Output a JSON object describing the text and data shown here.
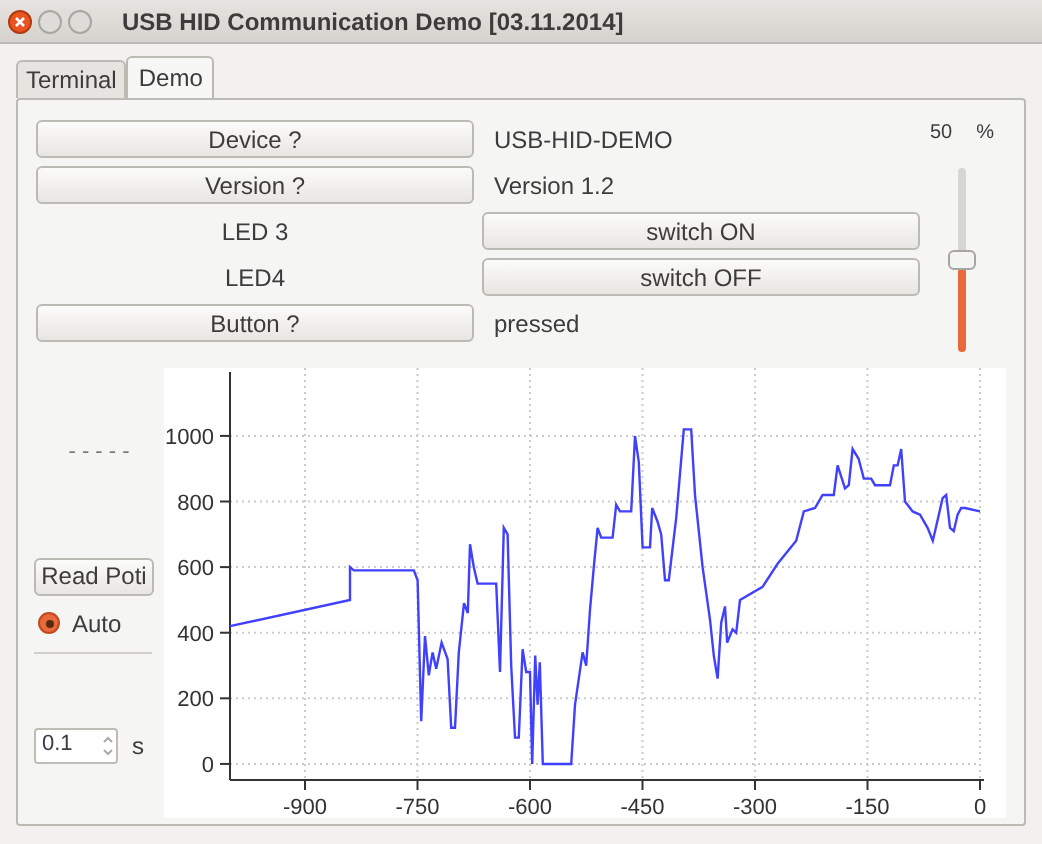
{
  "window": {
    "title": "USB HID Communication Demo [03.11.2014]"
  },
  "tabs": [
    {
      "label": "Terminal",
      "selected": false
    },
    {
      "label": "Demo",
      "selected": true
    }
  ],
  "rows": [
    {
      "kind": "query",
      "label": "Device ?",
      "value": "USB-HID-DEMO"
    },
    {
      "kind": "query",
      "label": "Version ?",
      "value": "Version 1.2"
    },
    {
      "kind": "switch",
      "label": "LED 3",
      "button": "switch ON"
    },
    {
      "kind": "switch",
      "label": "LED4",
      "button": "switch OFF"
    },
    {
      "kind": "query",
      "label": "Button ?",
      "value": "pressed"
    }
  ],
  "slider": {
    "reading": "50",
    "unit": "%",
    "level": 0.5
  },
  "poti": {
    "reading": "- - - - -",
    "button": "Read Poti",
    "auto": {
      "label": "Auto",
      "selected": true
    },
    "interval": {
      "value": "0.1",
      "unit": "s"
    }
  },
  "chart": {
    "chart_data": {
      "type": "line",
      "grid": true,
      "xlim": [
        -1000,
        0
      ],
      "ylim": [
        -49,
        1207
      ],
      "xticks": [
        -900,
        -750,
        -600,
        -450,
        -300,
        -150,
        0
      ],
      "yticks": [
        0,
        200,
        400,
        600,
        800,
        1000
      ],
      "x": [
        -1000,
        -840,
        -840,
        -835,
        -755,
        -750,
        -745,
        -740,
        -735,
        -730,
        -725,
        -718,
        -710,
        -705,
        -700,
        -695,
        -688,
        -683,
        -680,
        -675,
        -670,
        -645,
        -640,
        -635,
        -630,
        -625,
        -620,
        -615,
        -610,
        -605,
        -600,
        -597,
        -593,
        -590,
        -587,
        -583,
        -545,
        -540,
        -530,
        -525,
        -520,
        -515,
        -510,
        -505,
        -490,
        -485,
        -480,
        -465,
        -460,
        -455,
        -450,
        -440,
        -437,
        -430,
        -425,
        -420,
        -415,
        -405,
        -395,
        -385,
        -380,
        -370,
        -360,
        -355,
        -350,
        -345,
        -340,
        -337,
        -330,
        -325,
        -320,
        -290,
        -270,
        -245,
        -235,
        -220,
        -210,
        -195,
        -190,
        -180,
        -175,
        -170,
        -162,
        -155,
        -145,
        -140,
        -120,
        -115,
        -110,
        -105,
        -100,
        -90,
        -80,
        -70,
        -63,
        -58,
        -50,
        -45,
        -40,
        -35,
        -30,
        -25,
        -20,
        0
      ],
      "series": [
        {
          "color": "#4040ff",
          "values": [
            420,
            500,
            600,
            590,
            590,
            560,
            130,
            390,
            270,
            340,
            290,
            370,
            320,
            110,
            110,
            340,
            490,
            460,
            670,
            600,
            550,
            550,
            280,
            720,
            700,
            300,
            80,
            80,
            350,
            280,
            280,
            0,
            330,
            180,
            310,
            0,
            0,
            180,
            340,
            300,
            470,
            600,
            720,
            690,
            690,
            790,
            770,
            770,
            1000,
            920,
            660,
            660,
            780,
            740,
            700,
            560,
            560,
            750,
            1020,
            1020,
            820,
            600,
            440,
            330,
            260,
            430,
            480,
            370,
            410,
            400,
            500,
            540,
            610,
            680,
            770,
            780,
            820,
            820,
            910,
            840,
            850,
            960,
            930,
            870,
            870,
            850,
            850,
            910,
            910,
            960,
            800,
            770,
            760,
            720,
            680,
            730,
            810,
            820,
            720,
            710,
            760,
            780,
            780,
            770
          ]
        }
      ]
    }
  }
}
